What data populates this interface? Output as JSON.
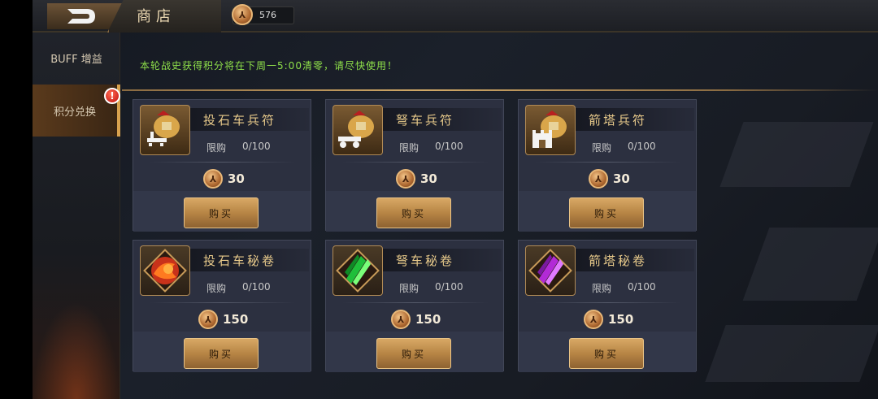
{
  "header": {
    "title": "商店",
    "currency_value": "576"
  },
  "sidebar": {
    "items": [
      {
        "label": "BUFF 增益"
      },
      {
        "label": "积分兑换",
        "badge": "!"
      }
    ]
  },
  "notice": "本轮战史获得积分将在下周一5:00清零，请尽快使用！",
  "limit_label": "限购",
  "buy_label": "购买",
  "cards": [
    {
      "name": "投石车兵符",
      "limit": "0/100",
      "price": "30",
      "icon": "catapult-tally-icon"
    },
    {
      "name": "弩车兵符",
      "limit": "0/100",
      "price": "30",
      "icon": "ballista-tally-icon"
    },
    {
      "name": "箭塔兵符",
      "limit": "0/100",
      "price": "30",
      "icon": "arrow-tower-tally-icon"
    },
    {
      "name": "投石车秘卷",
      "limit": "0/100",
      "price": "150",
      "icon": "red-scroll-icon"
    },
    {
      "name": "弩车秘卷",
      "limit": "0/100",
      "price": "150",
      "icon": "green-scroll-icon"
    },
    {
      "name": "箭塔秘卷",
      "limit": "0/100",
      "price": "150",
      "icon": "purple-scroll-icon"
    }
  ],
  "colors": {
    "notice": "#8fe04a",
    "gold_button": "#c99556",
    "item_name": "#e7c98a",
    "badge": "#d01818"
  }
}
